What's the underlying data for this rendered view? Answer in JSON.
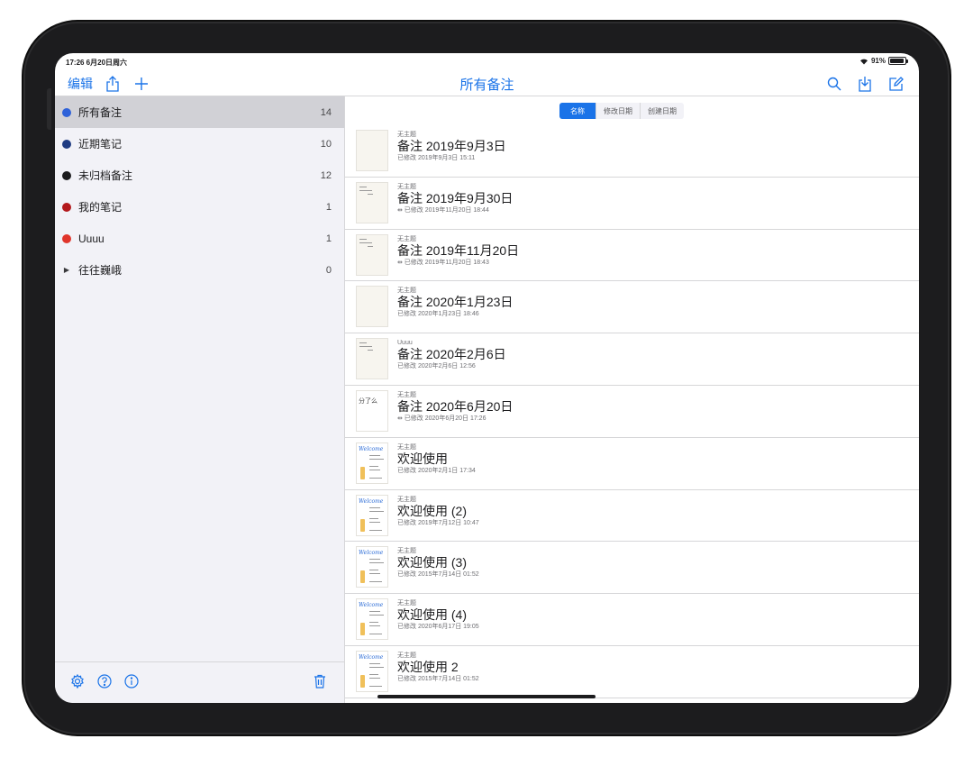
{
  "status": {
    "time": "17:26  6月20日周六",
    "battery": "91%"
  },
  "nav": {
    "edit": "编辑",
    "title": "所有备注"
  },
  "sidebar": {
    "items": [
      {
        "label": "所有备注",
        "count": "14",
        "color": "#2f62d9",
        "active": true
      },
      {
        "label": "近期笔记",
        "count": "10",
        "color": "#1f3b82"
      },
      {
        "label": "未归档备注",
        "count": "12",
        "color": "#1c1c1e"
      },
      {
        "label": "我的笔记",
        "count": "1",
        "color": "#b3191c"
      },
      {
        "label": "Uuuu",
        "count": "1",
        "color": "#e0352b"
      },
      {
        "label": "往往巍峨",
        "count": "0",
        "color": null
      }
    ]
  },
  "sort": {
    "options": [
      "名称",
      "修改日期",
      "创建日期"
    ],
    "selected": "名称"
  },
  "notes": [
    {
      "folder": "无主题",
      "title": "备注 2019年9月3日",
      "date": "已修改 2019年9月3日 15:11",
      "thumb": "blank"
    },
    {
      "folder": "无主题",
      "title": "备注 2019年9月30日",
      "date": "⇹ 已修改 2019年11月20日 18:44",
      "thumb": "lines"
    },
    {
      "folder": "无主题",
      "title": "备注 2019年11月20日",
      "date": "⇹ 已修改 2019年11月20日 18:43",
      "thumb": "lines"
    },
    {
      "folder": "无主题",
      "title": "备注 2020年1月23日",
      "date": "已修改 2020年1月23日 18:46",
      "thumb": "blank"
    },
    {
      "folder": "Uuuu",
      "title": "备注 2020年2月6日",
      "date": "已修改 2020年2月6日 12:56",
      "thumb": "lines"
    },
    {
      "folder": "无主题",
      "title": "备注 2020年6月20日",
      "date": "⇹ 已修改 2020年6月20日 17:26",
      "thumb": "scribble"
    },
    {
      "folder": "无主题",
      "title": "欢迎使用",
      "date": "已修改 2020年2月1日 17:34",
      "thumb": "welcome"
    },
    {
      "folder": "无主题",
      "title": "欢迎使用 (2)",
      "date": "已修改 2019年7月12日 10:47",
      "thumb": "welcome"
    },
    {
      "folder": "无主题",
      "title": "欢迎使用 (3)",
      "date": "已修改 2015年7月14日 01:52",
      "thumb": "welcome"
    },
    {
      "folder": "无主题",
      "title": "欢迎使用 (4)",
      "date": "已修改 2020年6月17日 19:05",
      "thumb": "welcome"
    },
    {
      "folder": "无主题",
      "title": "欢迎使用 2",
      "date": "已修改 2015年7月14日 01:52",
      "thumb": "welcome"
    }
  ],
  "thumb_texts": {
    "scribble": "分了么",
    "welcome": "Welcome"
  },
  "colors": {
    "accent": "#1a73e8",
    "sidebar_bg": "#f2f2f7",
    "selected_row": "#d1d1d6"
  }
}
